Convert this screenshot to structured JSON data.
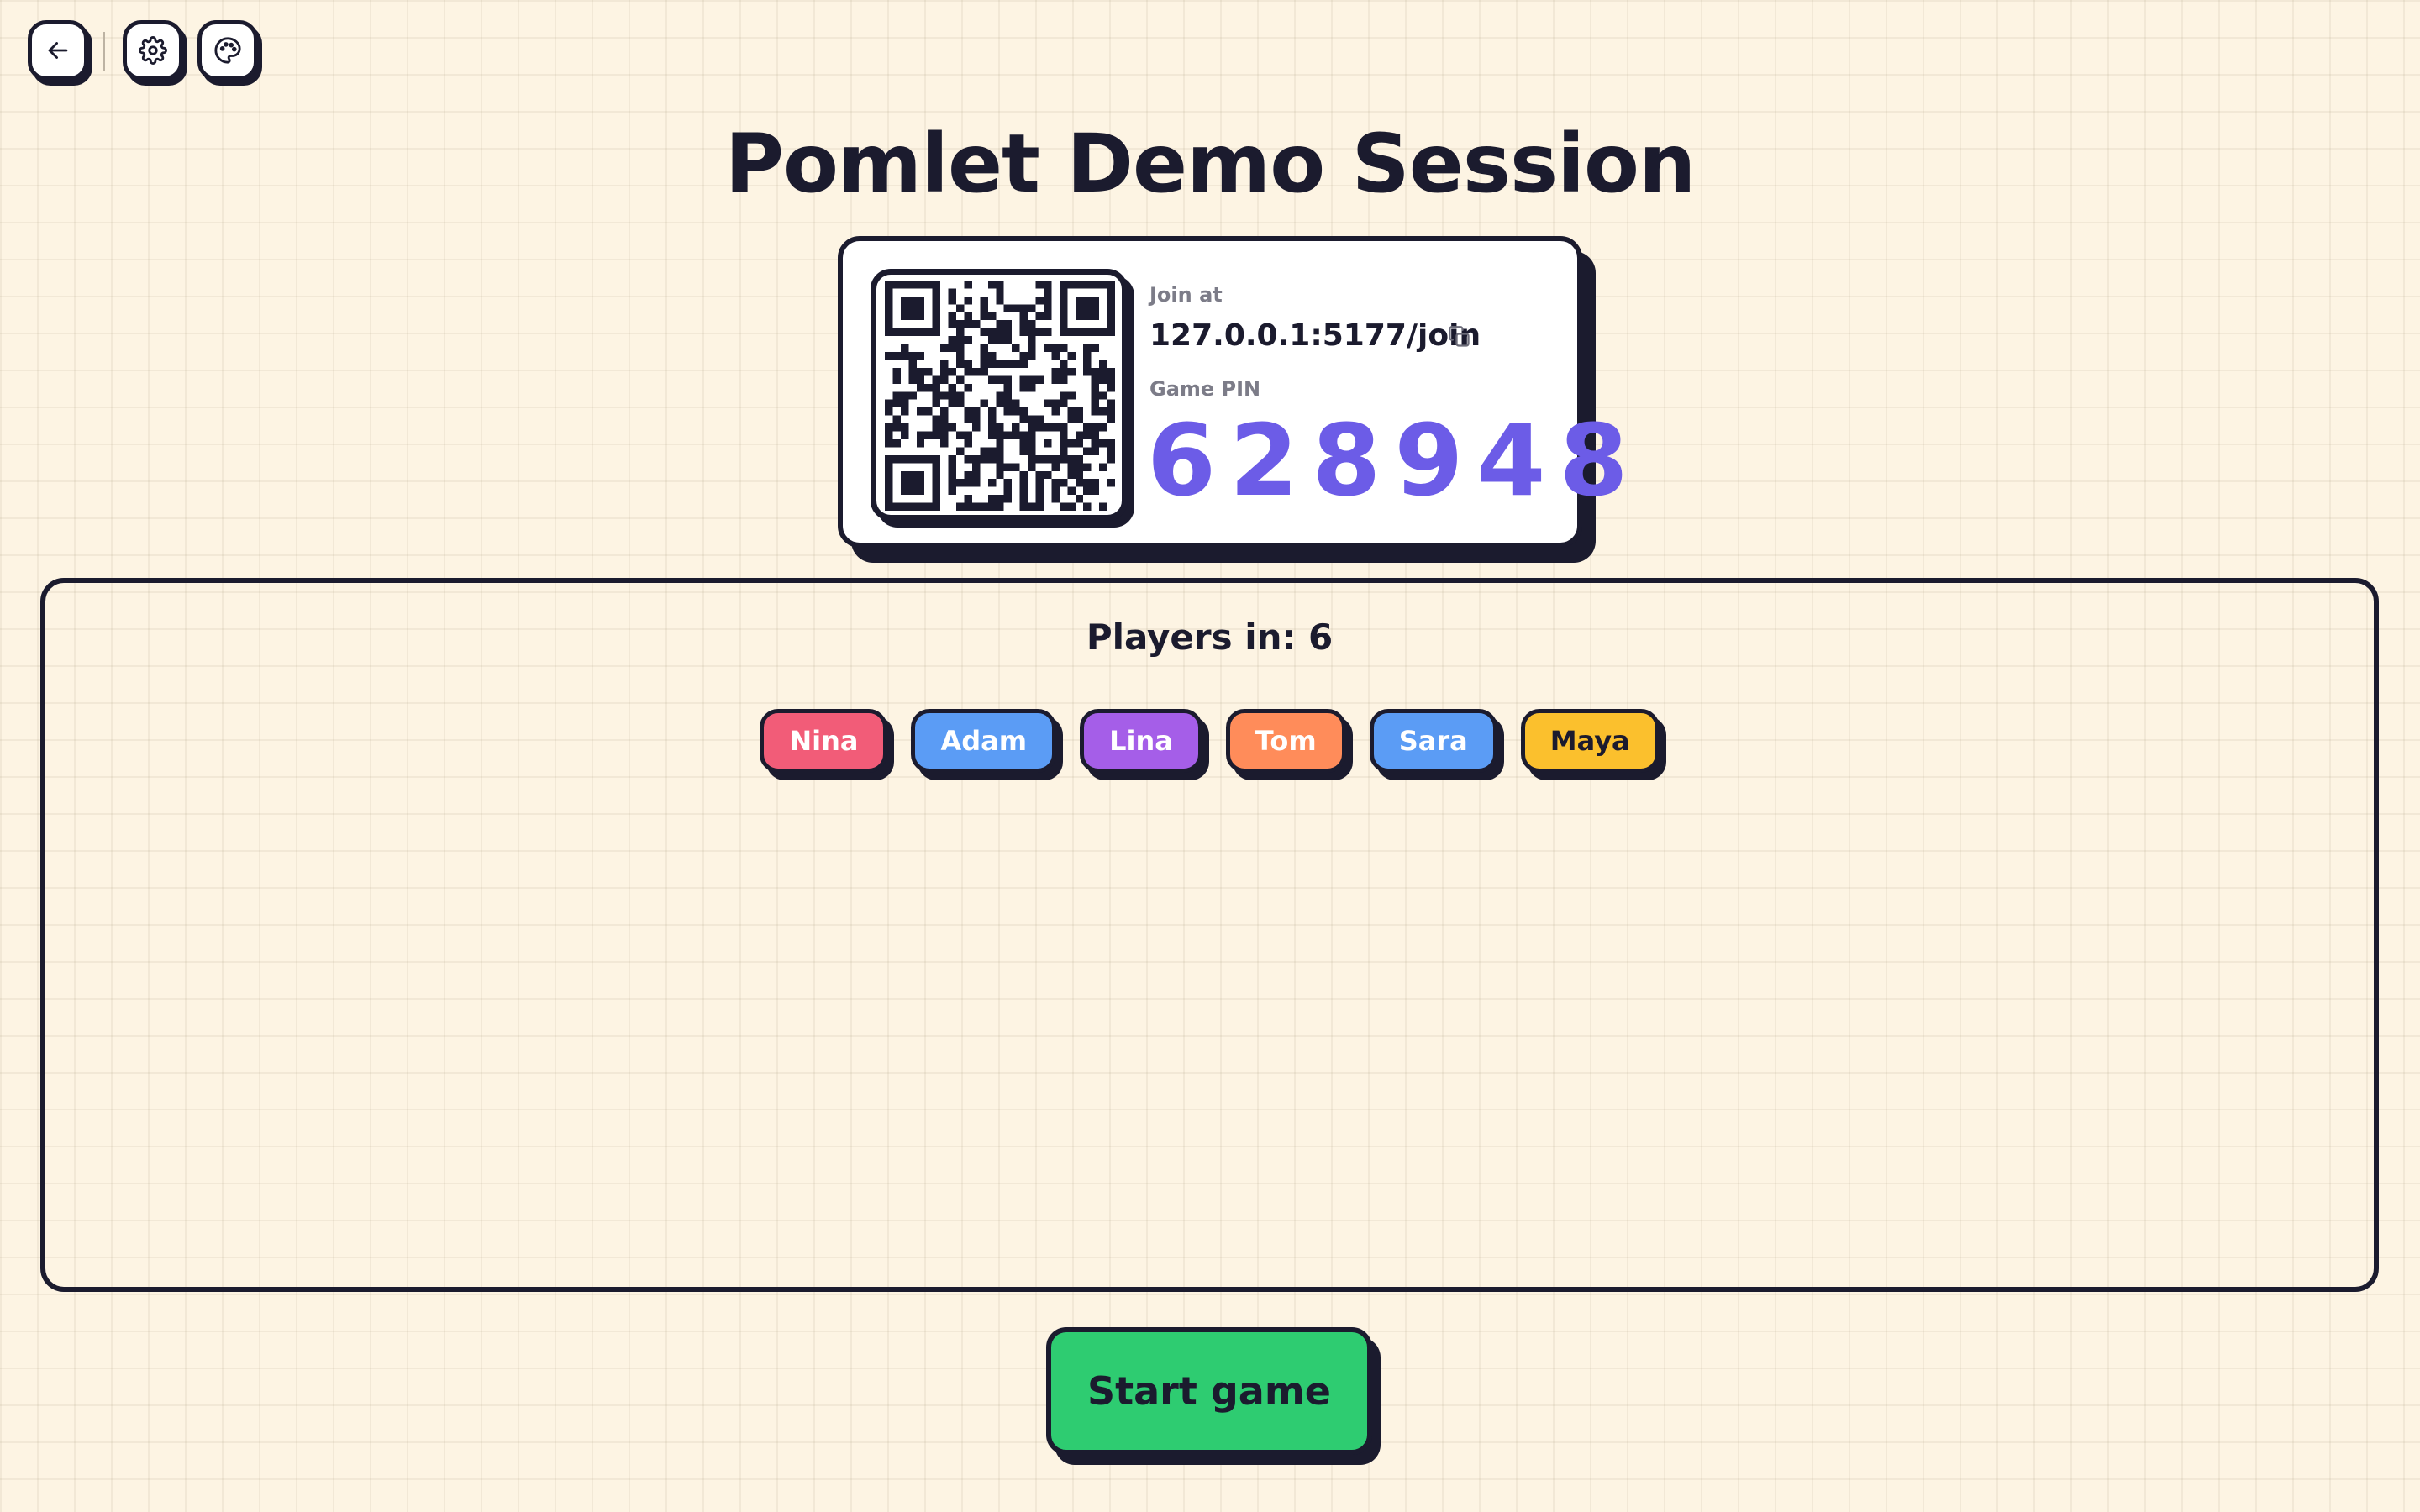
{
  "toolbar": {
    "back_icon": "arrow-left-icon",
    "settings_icon": "gear-icon",
    "theme_icon": "palette-icon"
  },
  "page": {
    "title": "Pomlet Demo Session"
  },
  "join": {
    "label": "Join at",
    "url": "127.0.0.1:5177/join",
    "copy_icon": "copy-icon",
    "pin_label": "Game PIN",
    "pin": "628948",
    "pin_color": "#6c5ce7",
    "qr_icon": "qr-code"
  },
  "players": {
    "title": "Players in: 6",
    "list": [
      {
        "name": "Nina",
        "color": "#f25c78",
        "text_color": "#ffffff"
      },
      {
        "name": "Adam",
        "color": "#5b9cf5",
        "text_color": "#ffffff"
      },
      {
        "name": "Lina",
        "color": "#a55ee8",
        "text_color": "#ffffff"
      },
      {
        "name": "Tom",
        "color": "#ff8c5a",
        "text_color": "#ffffff"
      },
      {
        "name": "Sara",
        "color": "#5b9cf5",
        "text_color": "#ffffff"
      },
      {
        "name": "Maya",
        "color": "#fbc02d",
        "text_color": "#1b1b2e"
      }
    ]
  },
  "actions": {
    "start_label": "Start game",
    "start_color": "#2ecc71"
  }
}
